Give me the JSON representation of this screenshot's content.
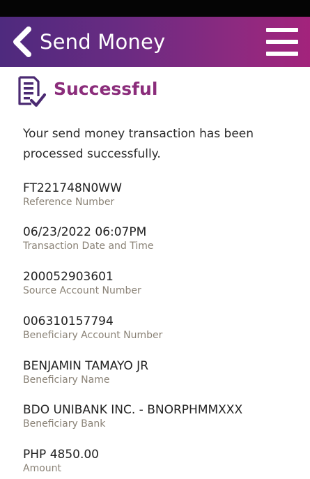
{
  "header": {
    "title": "Send Money"
  },
  "status": {
    "title": "Successful",
    "message": "Your send money transaction has been processed successfully."
  },
  "details": [
    {
      "value": "FT221748N0WW",
      "label": "Reference Number"
    },
    {
      "value": "06/23/2022 06:07PM",
      "label": "Transaction Date and Time"
    },
    {
      "value": "200052903601",
      "label": "Source Account Number"
    },
    {
      "value": "006310157794",
      "label": "Beneficiary Account Number"
    },
    {
      "value": "BENJAMIN TAMAYO JR",
      "label": "Beneficiary Name"
    },
    {
      "value": "BDO UNIBANK INC. - BNORPHMMXXX",
      "label": "Beneficiary Bank"
    },
    {
      "value": "PHP 4850.00",
      "label": "Amount"
    }
  ],
  "icons": {
    "back": "chevron-left-icon",
    "menu": "hamburger-menu-icon",
    "success": "document-check-icon"
  },
  "colors": {
    "header_gradient_start": "#4e2a7e",
    "header_gradient_end": "#a3237c",
    "success_title": "#8b2d7b",
    "icon": "#4b2a72",
    "label_text": "#8a8276"
  }
}
